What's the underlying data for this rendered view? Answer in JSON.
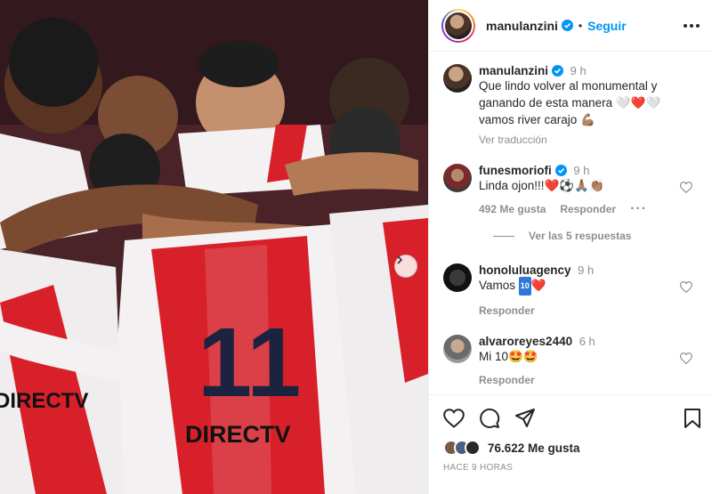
{
  "post": {
    "author": "manulanzini",
    "follow_label": "Seguir",
    "separator": "•"
  },
  "caption": {
    "username": "manulanzini",
    "time": "9 h",
    "text": "Que lindo volver al monumental y ganando de esta manera 🤍❤️🤍 vamos river carajo 💪🏽",
    "translate_label": "Ver traducción"
  },
  "comments": [
    {
      "username": "funesmoriofi",
      "time": "9 h",
      "text": "Linda ojon!!!❤️⚽️🙏🏽👏🏽",
      "likes": "492 Me gusta",
      "reply_label": "Responder",
      "view_replies": "Ver las 5 respuestas"
    },
    {
      "username": "honoluluagency",
      "time": "9 h",
      "text_prefix": "Vamos",
      "badge": "10",
      "text_suffix": "❤️",
      "reply_label": "Responder"
    },
    {
      "username": "alvaroreyes2440",
      "time": "6 h",
      "text": "Mi 10🤩🤩",
      "reply_label": "Responder"
    }
  ],
  "photo": {
    "jersey_number": "11",
    "sponsor_center": "DIRECTV",
    "sponsor_left": "DIRECTV",
    "colors": {
      "red": "#d8202a",
      "white": "#f3f1f2",
      "navy": "#1c2340",
      "skin": "#a86d4a"
    }
  },
  "footer": {
    "likes": "76.622 Me gusta",
    "timestamp": "HACE 9 HORAS"
  },
  "icons": [
    "verified-badge-icon",
    "more-options-icon",
    "heart-icon",
    "comment-icon",
    "share-icon",
    "bookmark-icon",
    "chevron-right-icon"
  ],
  "colors": {
    "link_blue": "#0095f6",
    "muted": "#8e8e8e",
    "text": "#262626",
    "like_red": "#ed1c24"
  }
}
